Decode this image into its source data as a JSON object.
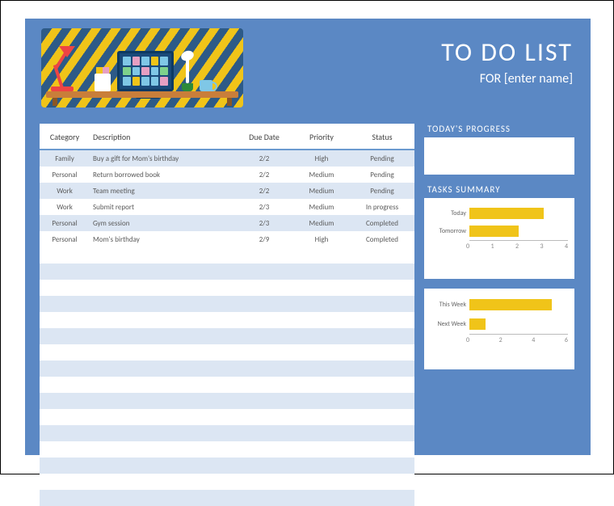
{
  "header": {
    "title": "TO DO LIST",
    "subtitle": "FOR [enter name]"
  },
  "table": {
    "columns": [
      "Category",
      "Description",
      "Due Date",
      "Priority",
      "Status"
    ],
    "rows": [
      {
        "category": "Family",
        "description": "Buy a gift for Mom's birthday",
        "due": "2/2",
        "priority": "High",
        "status": "Pending"
      },
      {
        "category": "Personal",
        "description": "Return borrowed book",
        "due": "2/2",
        "priority": "Medium",
        "status": "Pending"
      },
      {
        "category": "Work",
        "description": "Team meeting",
        "due": "2/2",
        "priority": "Medium",
        "status": "Pending"
      },
      {
        "category": "Work",
        "description": "Submit report",
        "due": "2/3",
        "priority": "Medium",
        "status": "In progress"
      },
      {
        "category": "Personal",
        "description": "Gym session",
        "due": "2/3",
        "priority": "Medium",
        "status": "Completed"
      },
      {
        "category": "Personal",
        "description": "Mom's birthday",
        "due": "2/9",
        "priority": "High",
        "status": "Completed"
      }
    ]
  },
  "progress": {
    "title": "TODAY'S PROGRESS"
  },
  "summary": {
    "title": "TASKS SUMMARY"
  },
  "chart_data": [
    {
      "type": "bar",
      "orientation": "horizontal",
      "categories": [
        "Today",
        "Tomorrow"
      ],
      "values": [
        3,
        2
      ],
      "xlim": [
        0,
        4
      ],
      "ticks": [
        0,
        1,
        2,
        3,
        4
      ],
      "title": "",
      "xlabel": "",
      "ylabel": ""
    },
    {
      "type": "bar",
      "orientation": "horizontal",
      "categories": [
        "This Week",
        "Next Week"
      ],
      "values": [
        5,
        1
      ],
      "xlim": [
        0,
        6
      ],
      "ticks": [
        0,
        2,
        4,
        6
      ],
      "title": "",
      "xlabel": "",
      "ylabel": ""
    }
  ],
  "colors": {
    "accent": "#5b88c4",
    "bar": "#f0c419",
    "stripe": "#dce6f3"
  }
}
